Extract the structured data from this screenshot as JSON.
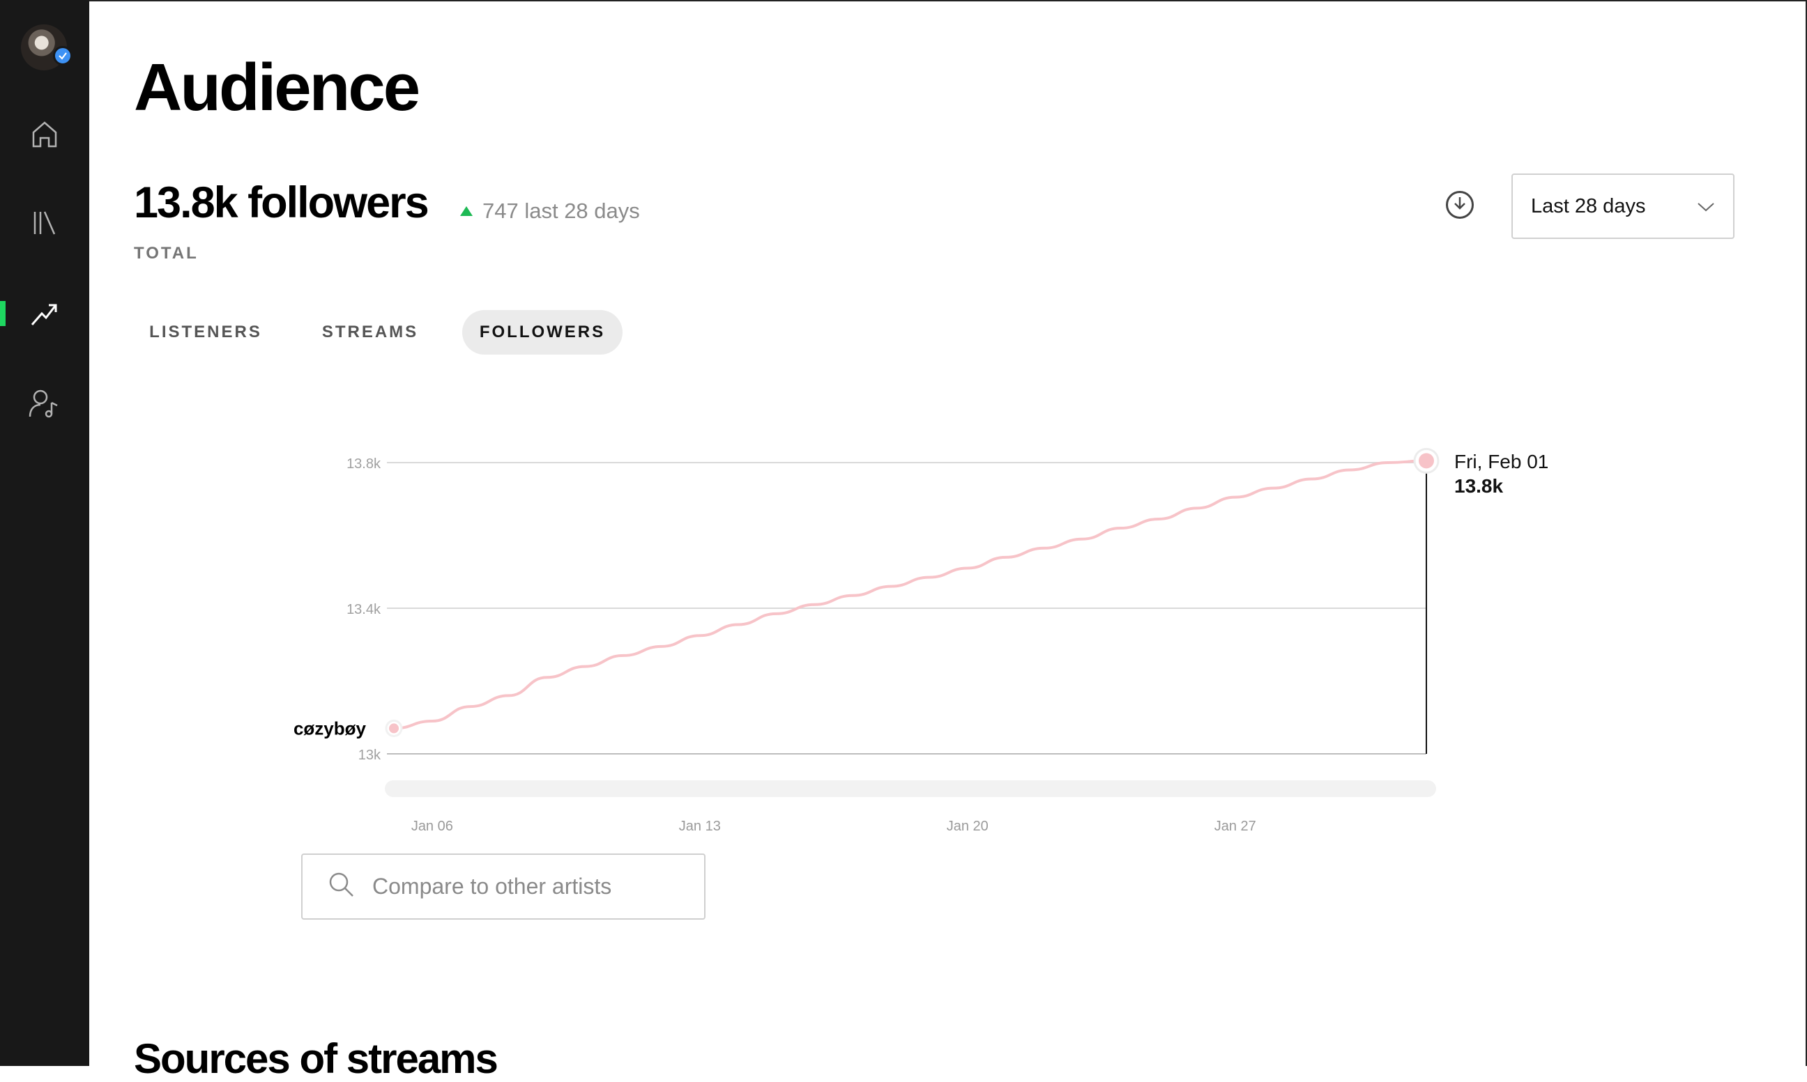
{
  "page": {
    "title": "Audience"
  },
  "summary": {
    "total": "13.8k followers",
    "delta": "747 last 28 days",
    "total_label": "TOTAL"
  },
  "controls": {
    "date_range": "Last 28 days"
  },
  "tabs": [
    {
      "label": "LISTENERS",
      "active": false
    },
    {
      "label": "STREAMS",
      "active": false
    },
    {
      "label": "FOLLOWERS",
      "active": true
    }
  ],
  "compare": {
    "placeholder": "Compare to other artists"
  },
  "next_section": {
    "title": "Sources of streams"
  },
  "colors": {
    "accent": "#1ed760",
    "series": "#f7c3c8",
    "sidebar": "#181818"
  },
  "icons": [
    "avatar",
    "verified-badge-icon",
    "home-icon",
    "library-icon",
    "stats-icon",
    "artist-profile-icon",
    "download-icon",
    "chevron-down-icon",
    "search-icon"
  ],
  "chart_data": {
    "type": "line",
    "x": [
      "Jan 05",
      "Jan 06",
      "Jan 07",
      "Jan 08",
      "Jan 09",
      "Jan 10",
      "Jan 11",
      "Jan 12",
      "Jan 13",
      "Jan 14",
      "Jan 15",
      "Jan 16",
      "Jan 17",
      "Jan 18",
      "Jan 19",
      "Jan 20",
      "Jan 21",
      "Jan 22",
      "Jan 23",
      "Jan 24",
      "Jan 25",
      "Jan 26",
      "Jan 27",
      "Jan 28",
      "Jan 29",
      "Jan 30",
      "Jan 31",
      "Feb 01"
    ],
    "series": [
      {
        "name": "cøzybøy",
        "values": [
          13070,
          13090,
          13130,
          13160,
          13210,
          13240,
          13270,
          13295,
          13325,
          13355,
          13385,
          13410,
          13435,
          13460,
          13485,
          13510,
          13540,
          13565,
          13590,
          13620,
          13645,
          13675,
          13705,
          13730,
          13755,
          13780,
          13800,
          13805
        ]
      }
    ],
    "xticks": [
      "Jan 06",
      "Jan 13",
      "Jan 20",
      "Jan 27"
    ],
    "yticks": [
      "13k",
      "13.4k",
      "13.8k"
    ],
    "ylim": [
      13000,
      13800
    ],
    "grid": true,
    "tooltip": {
      "date": "Fri, Feb 01",
      "value": "13.8k"
    }
  }
}
